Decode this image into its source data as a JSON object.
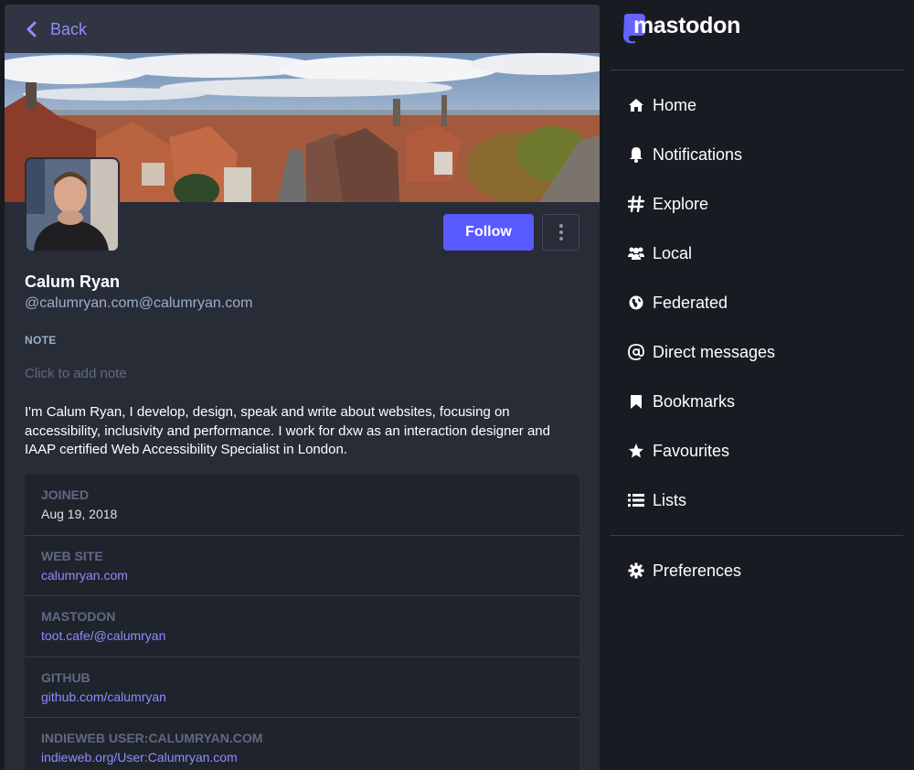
{
  "column": {
    "back_label": "Back"
  },
  "profile": {
    "display_name": "Calum Ryan",
    "acct": "@calumryan.com@calumryan.com",
    "follow_label": "Follow",
    "note_label": "NOTE",
    "note_placeholder": "Click to add note",
    "bio": "I'm Calum Ryan, I develop, design, speak and write about websites, focusing on accessibility, inclusivity and performance. I work for dxw as an interaction designer and IAAP certified Web Accessibility Specialist in London.",
    "fields": [
      {
        "name": "JOINED",
        "value": "Aug 19, 2018",
        "link": false
      },
      {
        "name": "WEB SITE",
        "value": "calumryan.com",
        "link": true
      },
      {
        "name": "MASTODON",
        "value": "toot.cafe/@calumryan",
        "link": true
      },
      {
        "name": "GITHUB",
        "value": "github.com/calumryan",
        "link": true
      },
      {
        "name": "INDIEWEB USER:CALUMRYAN.COM",
        "value": "indieweb.org/User:Calumryan.com",
        "link": true
      }
    ]
  },
  "nav": {
    "logo_text": "mastodon",
    "items": [
      {
        "label": "Home",
        "icon": "home-icon"
      },
      {
        "label": "Notifications",
        "icon": "bell-icon"
      },
      {
        "label": "Explore",
        "icon": "hashtag-icon"
      },
      {
        "label": "Local",
        "icon": "users-icon"
      },
      {
        "label": "Federated",
        "icon": "globe-icon"
      },
      {
        "label": "Direct messages",
        "icon": "at-icon"
      },
      {
        "label": "Bookmarks",
        "icon": "bookmark-icon"
      },
      {
        "label": "Favourites",
        "icon": "star-icon"
      },
      {
        "label": "Lists",
        "icon": "list-icon"
      }
    ],
    "preferences": {
      "label": "Preferences",
      "icon": "gear-icon"
    }
  },
  "colors": {
    "accent": "#595aff",
    "link": "#8c8dff",
    "column_bg": "#282c37",
    "app_bg": "#191b22"
  }
}
